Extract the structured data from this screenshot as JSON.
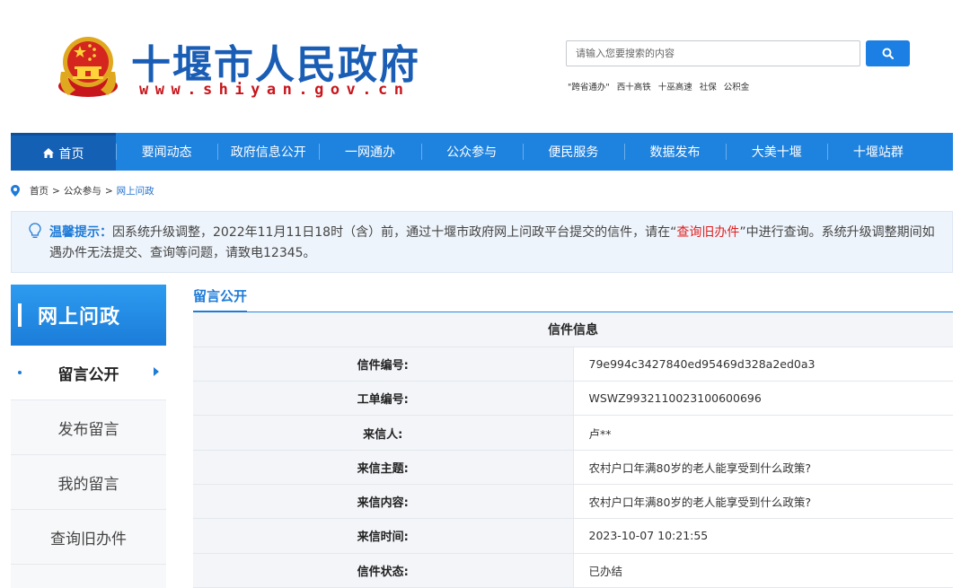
{
  "header": {
    "site_title": "十堰市人民政府",
    "site_url": "www.shiyan.gov.cn",
    "search": {
      "placeholder": "请输入您要搜索的内容"
    },
    "quick_links": [
      "\"跨省通办\"",
      "西十高铁",
      "十巫高速",
      "社保",
      "公积金"
    ]
  },
  "nav": {
    "items": [
      "首页",
      "要闻动态",
      "政府信息公开",
      "一网通办",
      "公众参与",
      "便民服务",
      "数据发布",
      "大美十堰",
      "十堰站群"
    ]
  },
  "breadcrumb": {
    "items": [
      "首页",
      "公众参与",
      "网上问政"
    ],
    "separator": ">"
  },
  "notice": {
    "label": "温馨提示：",
    "text_before": "因系统升级调整，2022年11月11日18时（含）前，通过十堰市政府网上问政平台提交的信件，请在“",
    "link": "查询旧办件",
    "text_after": "”中进行查询。系统升级调整期间如遇办件无法提交、查询等问题，请致电12345。"
  },
  "sidebar": {
    "title": "网上问政",
    "items": [
      "留言公开",
      "发布留言",
      "我的留言",
      "查询旧办件"
    ]
  },
  "content": {
    "section_title": "留言公开",
    "table_caption": "信件信息",
    "rows": [
      {
        "label": "信件编号:",
        "value": "79e994c3427840ed95469d328a2ed0a3"
      },
      {
        "label": "工单编号:",
        "value": "WSWZ9932110023100600696"
      },
      {
        "label": "来信人:",
        "value": "卢**"
      },
      {
        "label": "来信主题:",
        "value": "农村户口年满80岁的老人能享受到什么政策?"
      },
      {
        "label": "来信内容:",
        "value": "农村户口年满80岁的老人能享受到什么政策?"
      },
      {
        "label": "来信时间:",
        "value": "2023-10-07 10:21:55"
      },
      {
        "label": "信件状态:",
        "value": "已办结"
      }
    ]
  },
  "colors": {
    "primary_blue": "#1e82df",
    "title_blue": "#1a5db5",
    "url_red": "#c8161d",
    "link_red": "#e02020"
  },
  "icons": {
    "emblem": "national-emblem-icon",
    "search": "search-icon",
    "home": "home-icon",
    "location": "location-pin-icon",
    "tip": "lightbulb-icon",
    "arrow": "chevron-right-icon"
  }
}
